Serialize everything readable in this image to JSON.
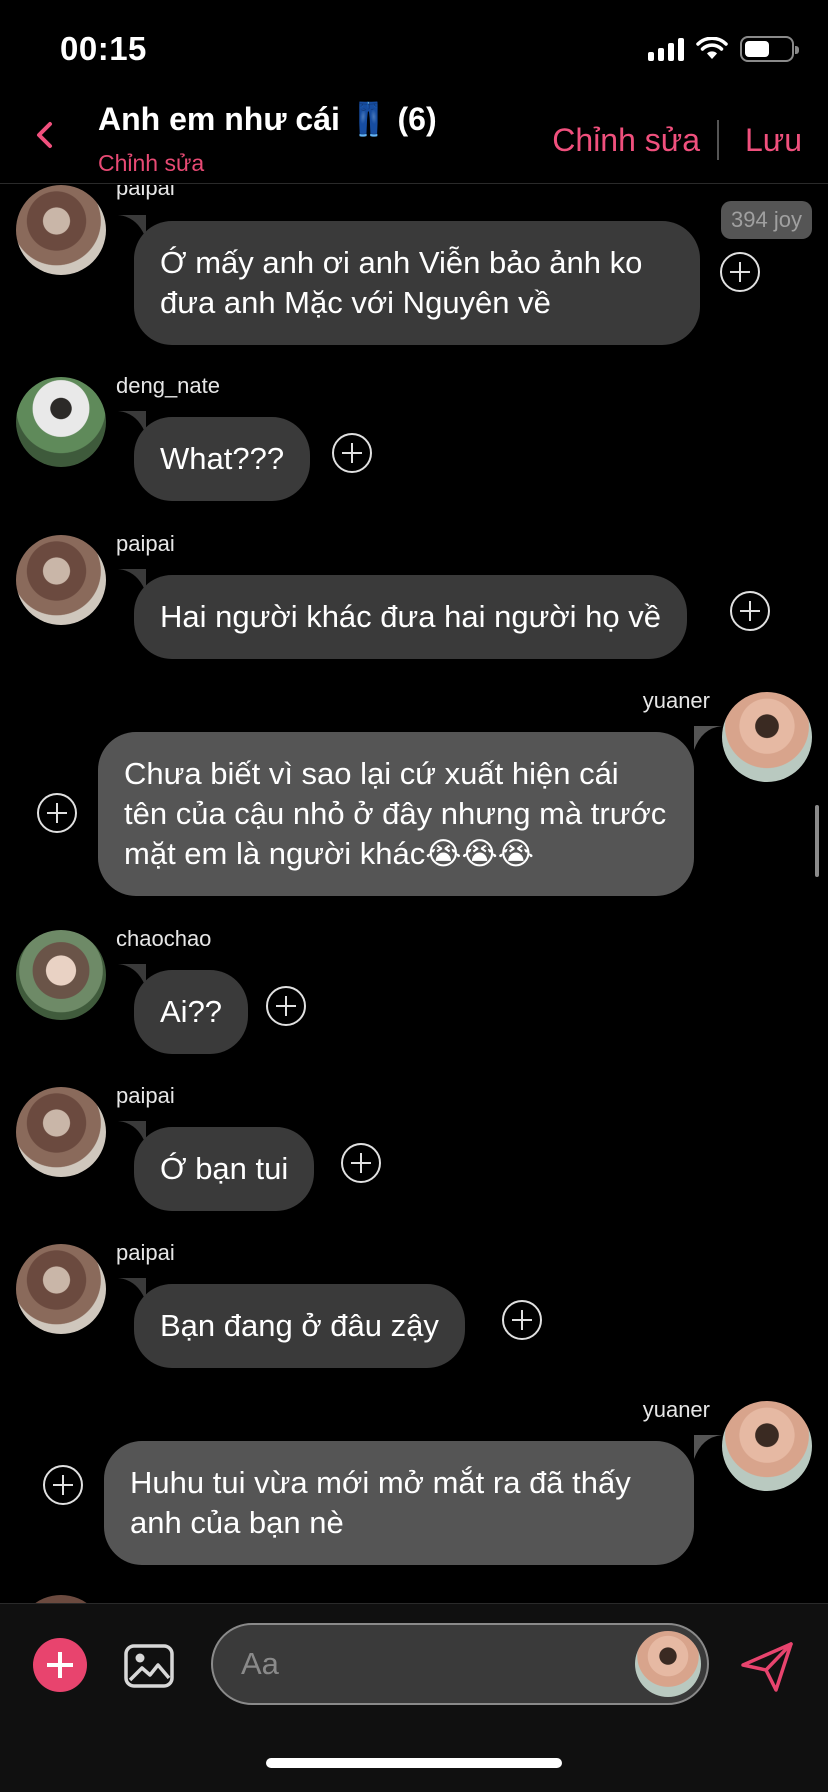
{
  "status_bar": {
    "time": "00:15",
    "battery_level": 0.55
  },
  "header": {
    "title": "Anh em như cái 👖 (6)",
    "subtitle": "Chỉnh sửa",
    "edit_label": "Chỉnh sửa",
    "save_label": "Lưu"
  },
  "badge": {
    "text": "394 joy"
  },
  "messages": [
    {
      "user": "paipai",
      "side": "left",
      "avatar": "avatar-paipai",
      "text": "Ớ mấy anh ơi anh Viễn bảo ảnh ko đưa anh Mặc với Nguyên về"
    },
    {
      "user": "deng_nate",
      "side": "left",
      "avatar": "avatar-deng_nate",
      "text": "What???"
    },
    {
      "user": "paipai",
      "side": "left",
      "avatar": "avatar-paipai",
      "text": "Hai người khác đưa hai người họ về"
    },
    {
      "user": "yuaner",
      "side": "right",
      "avatar": "avatar-yuaner",
      "text": "Chưa biết vì sao lại cứ xuất hiện cái tên của cậu nhỏ ở đây nhưng mà trước mặt em là người khác😭😭😭"
    },
    {
      "user": "chaochao",
      "side": "left",
      "avatar": "avatar-chaochao",
      "text": "Ai??"
    },
    {
      "user": "paipai",
      "side": "left",
      "avatar": "avatar-paipai",
      "text": "Ớ bạn tui"
    },
    {
      "user": "paipai",
      "side": "left",
      "avatar": "avatar-paipai",
      "text": "Bạn đang ở đâu zậy"
    },
    {
      "user": "yuaner",
      "side": "right",
      "avatar": "avatar-yuaner",
      "text": "Huhu tui vừa mới mở mắt ra đã thấy anh của bạn nè"
    }
  ],
  "composer": {
    "placeholder": "Aa"
  },
  "colors": {
    "accent": "#f0507d",
    "bubble_other": "#3a3a3a",
    "bubble_me": "#555555"
  }
}
